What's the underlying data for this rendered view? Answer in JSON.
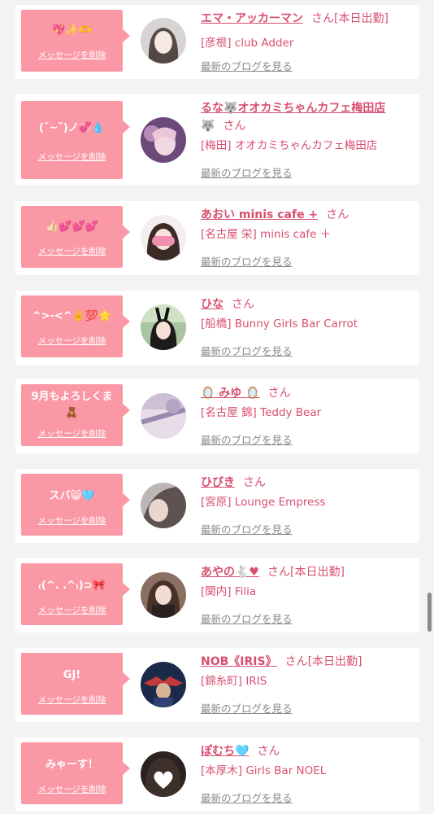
{
  "labels": {
    "delete": "メッセージを削除",
    "blog": "最新のブログを見る",
    "san": "さん"
  },
  "colors": {
    "bubble": "#fb98a6",
    "accent": "#d94f70",
    "link_gray": "#888888"
  },
  "entries": [
    {
      "message": "💖✨🫶",
      "name": "エマ・アッカーマン",
      "status": "[本日出勤]",
      "shop": "[彦根] club Adder"
    },
    {
      "message": "(ˇ~ˇ)ノ💞💧",
      "name": "るな🐺オオカミちゃんカフェ梅田店",
      "name_cont": "🐺",
      "status": "",
      "shop": "[梅田] オオカミちゃんカフェ梅田店"
    },
    {
      "message": "👍🏻💕💕💕",
      "name": "あおい minis cafe +",
      "status": "",
      "shop": "[名古屋 栄] minis cafe ＋"
    },
    {
      "message": "^>-<^✌️💯🌟",
      "name": "ひな",
      "status": "",
      "shop": "[船橋] Bunny Girls Bar Carrot"
    },
    {
      "message": "9月もよろしくま",
      "message2": "🧸",
      "name": "🪞 みゆ 🪞",
      "status": "",
      "shop": "[名古屋 錦] Teddy Bear"
    },
    {
      "message": "スバ😸🩵",
      "name": "ひびき",
      "status": "",
      "shop": "[宮原] Lounge Empress"
    },
    {
      "message": "₍(^. .^₎)⊃🎀",
      "name": "あやの🐇♥",
      "status": "[本日出勤]",
      "shop": "[関内] Filia"
    },
    {
      "message": "GJ!",
      "name": "NOB《IRIS》",
      "status": "[本日出勤]",
      "shop": "[錦糸町] IRIS"
    },
    {
      "message": "みゃーす！",
      "name": "ぽむち🩵",
      "status": "",
      "shop": "[本厚木] Girls Bar NOEL"
    }
  ]
}
